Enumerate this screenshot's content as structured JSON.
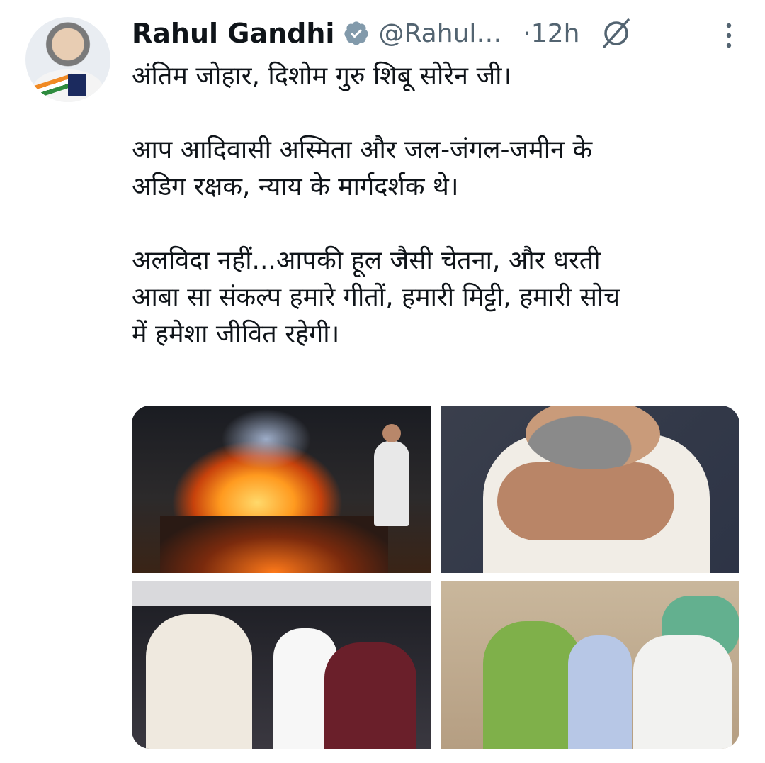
{
  "tweet": {
    "author_name": "Rahul Gandhi",
    "handle": "@Rahul…",
    "time": "·12h",
    "verified": true,
    "lines": [
      "अंतिम जोहार, दिशोम गुरु शिबू सोरेन जी।",
      "",
      "आप आदिवासी अस्मिता और जल-जंगल-जमीन के",
      "अडिग रक्षक, न्याय के मार्गदर्शक थे।",
      "",
      "अलविदा नहीं...आपकी हूल जैसी चेतना, और धरती",
      "आबा सा संकल्प हमारे गीतों, हमारी मिट्टी, हमारी सोच",
      "में हमेशा जीवित रहेगी।"
    ]
  },
  "colors": {
    "text_primary": "#0f1419",
    "text_secondary": "#536471",
    "verified_badge": "#829aab"
  },
  "icons": {
    "verified": "verified-badge-icon",
    "grok": "grok-icon",
    "more": "more-options-icon"
  },
  "media": [
    {
      "id": "photo-1"
    },
    {
      "id": "photo-2"
    },
    {
      "id": "photo-3"
    },
    {
      "id": "photo-4"
    }
  ]
}
